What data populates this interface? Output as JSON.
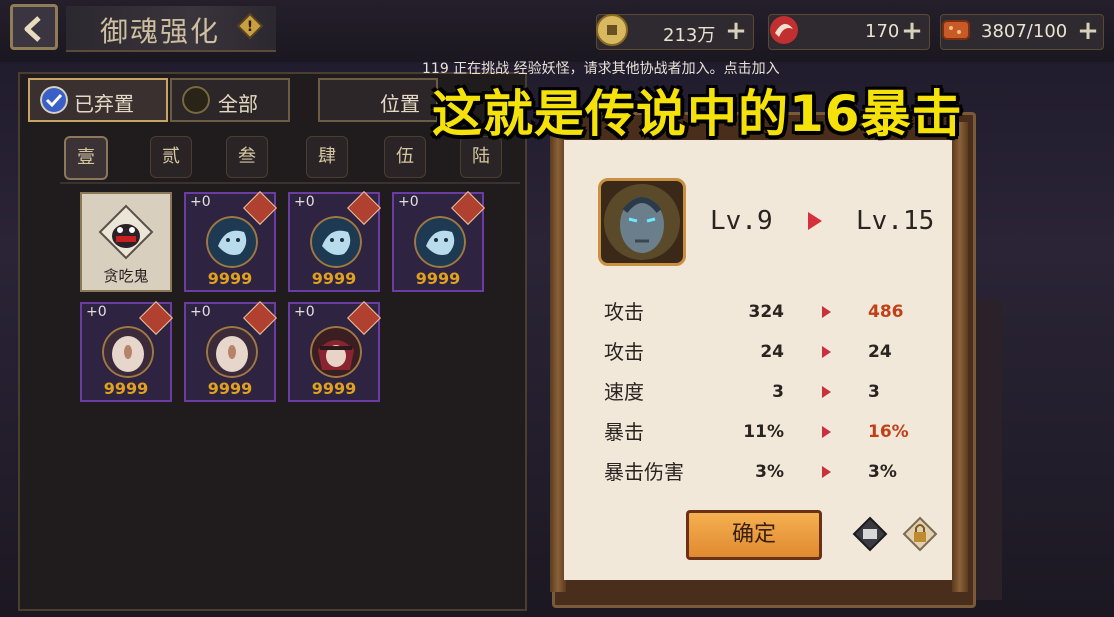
{
  "header": {
    "title": "御魂强化",
    "resources": [
      {
        "icon": "coin-icon",
        "value": "213万"
      },
      {
        "icon": "stamina-icon",
        "value": "170"
      },
      {
        "icon": "food-icon",
        "value": "3807/100"
      }
    ]
  },
  "filters": {
    "discarded": "已弃置",
    "all": "全部",
    "position": "位置"
  },
  "slot_tabs": [
    "壹",
    "贰",
    "叁",
    "肆",
    "伍",
    "陆"
  ],
  "cards": [
    {
      "name": "贪吃鬼",
      "special": true
    },
    {
      "level": "+0",
      "count": "9999",
      "portrait": "blue-spirit"
    },
    {
      "level": "+0",
      "count": "9999",
      "portrait": "blue-spirit"
    },
    {
      "level": "+0",
      "count": "9999",
      "portrait": "blue-spirit"
    },
    {
      "level": "+0",
      "count": "9999",
      "portrait": "pale-face"
    },
    {
      "level": "+0",
      "count": "9999",
      "portrait": "pale-face"
    },
    {
      "level": "+0",
      "count": "9999",
      "portrait": "red-hood"
    }
  ],
  "notice": "119 正在挑战 经验妖怪，请求其他协战者加入。点击加入",
  "banner": "这就是传说中的16暴击",
  "dialog": {
    "level_from": "Lv.9",
    "level_to": "Lv.15",
    "stats": [
      {
        "name": "攻击",
        "old": "324",
        "new": "486",
        "up": true
      },
      {
        "name": "攻击",
        "old": "24",
        "new": "24",
        "up": false
      },
      {
        "name": "速度",
        "old": "3",
        "new": "3",
        "up": false
      },
      {
        "name": "暴击",
        "old": "11%",
        "new": "16%",
        "up": true
      },
      {
        "name": "暴击伤害",
        "old": "3%",
        "new": "3%",
        "up": false
      }
    ],
    "confirm": "确定"
  },
  "colors": {
    "accent": "#f5e20a",
    "increase": "#c04018",
    "arrow": "#d6303a"
  }
}
